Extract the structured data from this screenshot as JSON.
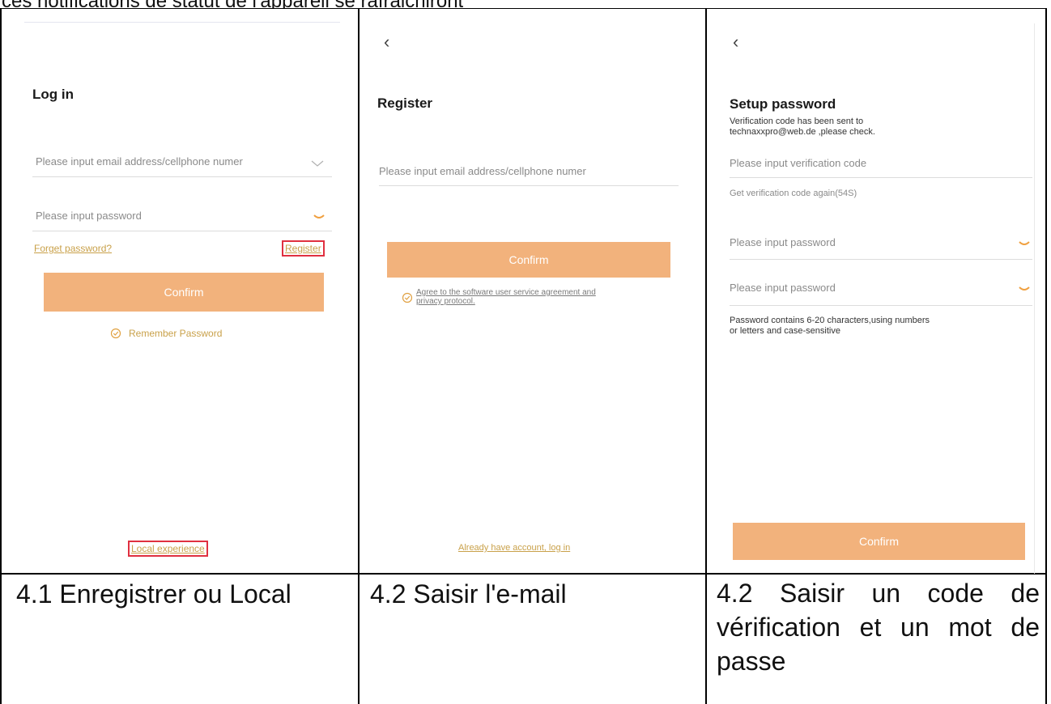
{
  "top_text": "ces notifications de statut de l'appareil se rafraichiront",
  "login": {
    "title": "Log in",
    "email_placeholder": "Please input email address/cellphone numer",
    "password_placeholder": "Please input password",
    "forget_password": "Forget password?",
    "register": "Register",
    "confirm": "Confirm",
    "remember_password": "Remember Password",
    "local_experience": "Local experience"
  },
  "register": {
    "title": "Register",
    "email_placeholder": "Please input email address/cellphone numer",
    "confirm": "Confirm",
    "agreement_line1": "Agree to the software user service agreement and",
    "agreement_line2": "privacy protocol.",
    "already_have_account": "Already have account, log in"
  },
  "setup": {
    "title": "Setup password",
    "sent_line1": "Verification code has been sent to",
    "sent_line2": "technaxxpro@web.de ,please check.",
    "code_placeholder": "Please input verification code",
    "resend": "Get verification code again(54S)",
    "password_placeholder": "Please input password",
    "password_confirm_placeholder": "Please input password",
    "hint_line1": "Password contains 6-20 characters,using numbers",
    "hint_line2": "or letters and case-sensitive",
    "confirm": "Confirm"
  },
  "captions": {
    "c1": "4.1 Enregistrer ou Local",
    "c2": "4.2 Saisir l'e-mail",
    "c3": "4.2 Saisir un code de vérification et un mot de passe"
  },
  "colors": {
    "accent": "#f2b27c",
    "link": "#c9a14a",
    "highlight": "#e03040"
  }
}
